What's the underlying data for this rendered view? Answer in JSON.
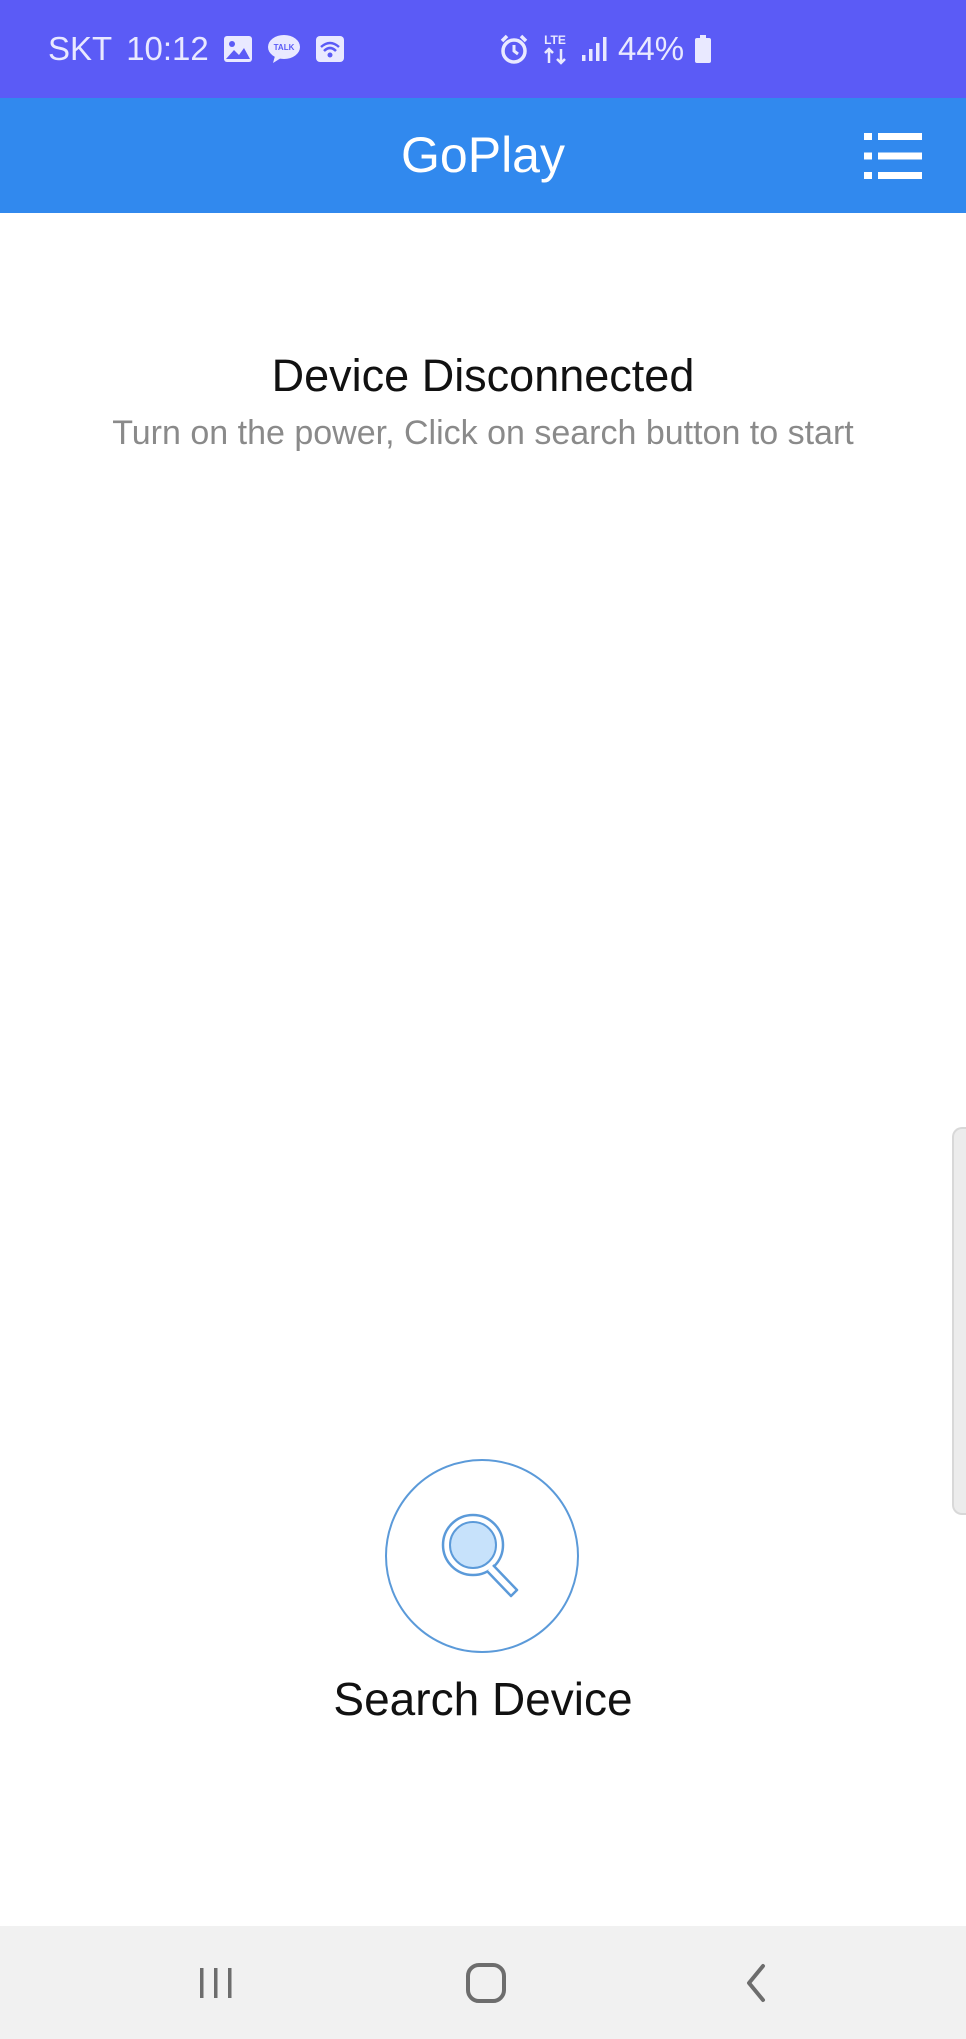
{
  "status_bar": {
    "carrier": "SKT",
    "time": "10:12",
    "network": "LTE",
    "battery": "44%",
    "background_color": "#5b5bf6",
    "left_icons": [
      "image-icon",
      "talk-icon",
      "wifi-icon"
    ],
    "right_icons": [
      "alarm-icon",
      "lte-icon",
      "signal-icon",
      "battery-icon"
    ],
    "talk_badge": "TALK"
  },
  "app_bar": {
    "title": "GoPlay",
    "background_color": "#3189ee",
    "menu_icon": "list-menu-icon"
  },
  "content": {
    "status_title": "Device Disconnected",
    "status_subtitle": "Turn on the power, Click on search button to start",
    "search_label": "Search Device",
    "search_icon": "magnifier-icon",
    "accent_color": "#5b9ad9"
  },
  "nav_bar": {
    "icons": [
      "recent-apps-icon",
      "home-icon",
      "back-icon"
    ]
  }
}
